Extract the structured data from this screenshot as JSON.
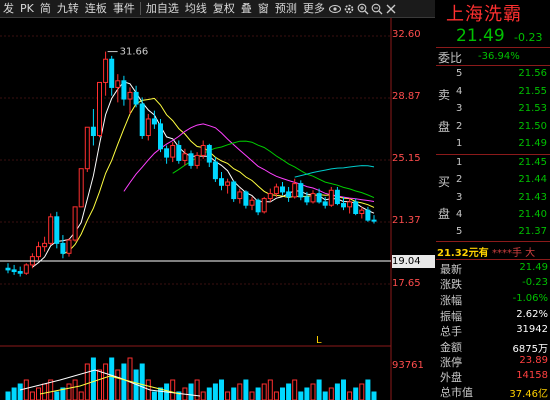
{
  "toolbar": {
    "items": [
      {
        "label": "发",
        "active": false
      },
      {
        "label": "PK",
        "active": false
      },
      {
        "label": "简",
        "active": false
      },
      {
        "label": "九转",
        "active": false
      },
      {
        "label": "连板",
        "active": false
      },
      {
        "label": "事件",
        "active": false
      },
      {
        "label": "加自选",
        "active": false
      },
      {
        "label": "均线",
        "active": false
      },
      {
        "label": "复权",
        "active": false
      },
      {
        "label": "叠",
        "active": false
      },
      {
        "label": "窗",
        "active": false
      },
      {
        "label": "预测",
        "active": false
      },
      {
        "label": "更多",
        "active": false
      }
    ]
  },
  "main_chart": {
    "peak_label": "31.66",
    "axis_labels": [
      "32.60",
      "28.87",
      "25.15",
      "21.37",
      "17.65",
      "93761"
    ],
    "current_price": "19.04",
    "marker": "L",
    "colors": {
      "up": "#ff3030",
      "down": "#00d8ff",
      "ma5": "#ffffff",
      "ma10": "#ffff40",
      "ma20": "#ff40ff",
      "ma30": "#00cc00",
      "ma60": "#00cccc",
      "price_line": "#ffffff"
    }
  },
  "quote": {
    "name": "上海洗霸",
    "price": "21.49",
    "price_change": "-0.23",
    "weibi_label": "委比",
    "weibi_value": "-36.94%",
    "sell_side_label": "卖盘",
    "buy_side_label": "买盘",
    "sell": [
      {
        "n": "5",
        "p": "21.56"
      },
      {
        "n": "4",
        "p": "21.55"
      },
      {
        "n": "3",
        "p": "21.53"
      },
      {
        "n": "2",
        "p": "21.50"
      },
      {
        "n": "1",
        "p": "21.49"
      }
    ],
    "buy": [
      {
        "n": "1",
        "p": "21.45"
      },
      {
        "n": "2",
        "p": "21.44"
      },
      {
        "n": "3",
        "p": "21.43"
      },
      {
        "n": "4",
        "p": "21.40"
      },
      {
        "n": "5",
        "p": "21.37"
      }
    ],
    "last_trade": {
      "price": "21.32元有",
      "qty": "****手 大"
    },
    "stats": [
      {
        "k": "最新",
        "v": "21.49",
        "c": "green"
      },
      {
        "k": "涨跌",
        "v": "-0.23",
        "c": "green"
      },
      {
        "k": "涨幅",
        "v": "-1.06%",
        "c": "green"
      },
      {
        "k": "振幅",
        "v": "2.62%",
        "c": "white"
      },
      {
        "k": "总手",
        "v": "31942",
        "c": "white"
      },
      {
        "k": "金额",
        "v": "6875万",
        "c": "white"
      },
      {
        "k": "涨停",
        "v": "23.89",
        "c": "red"
      },
      {
        "k": "外盘",
        "v": "14158",
        "c": "red"
      },
      {
        "k": "总市值",
        "v": "37.46亿",
        "c": "yellow"
      }
    ]
  }
}
